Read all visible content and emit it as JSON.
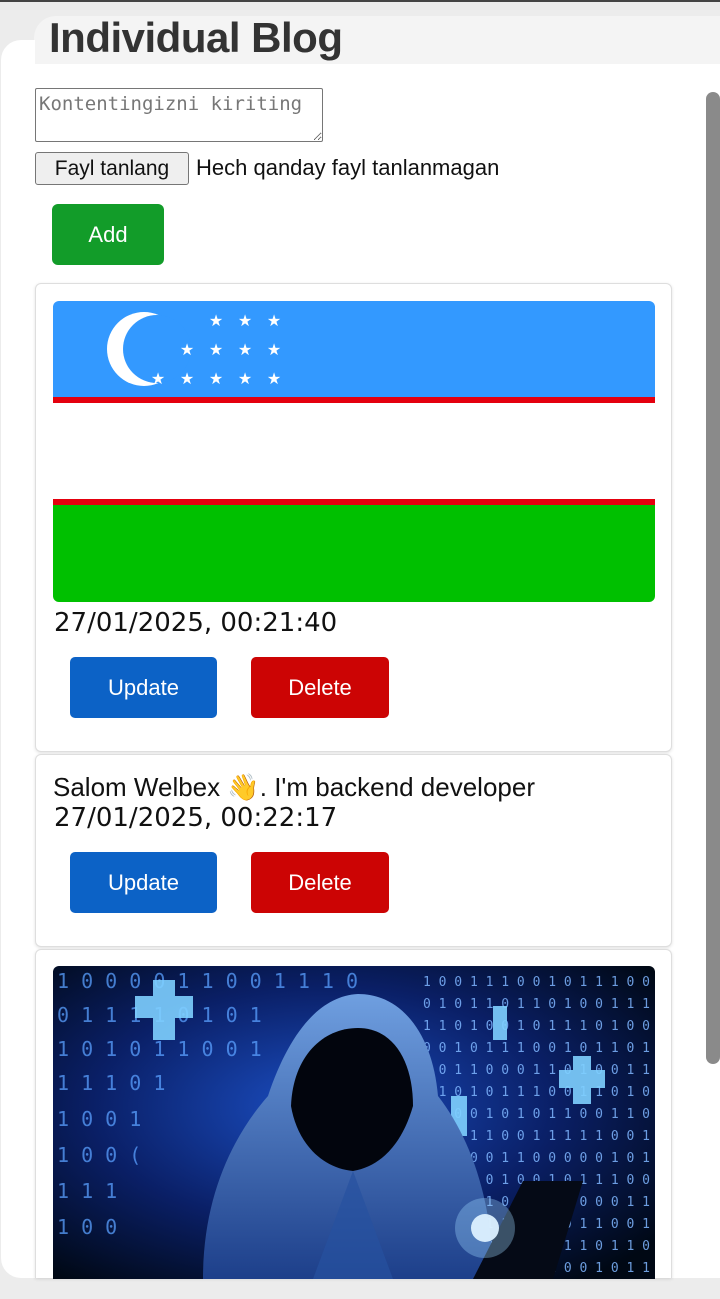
{
  "header": {
    "title": "Individual Blog"
  },
  "form": {
    "content_placeholder": "Kontentingizni kiriting",
    "file_button_label": "Fayl tanlang",
    "file_status": "Hech qanday fayl tanlanmagan",
    "add_label": "Add"
  },
  "posts": [
    {
      "kind": "image",
      "image": "uzbekistan-flag",
      "timestamp": "27/01/2025, 00:21:40",
      "update_label": "Update",
      "delete_label": "Delete"
    },
    {
      "kind": "text",
      "text_before": "Salom Welbex ",
      "emoji": "👋",
      "text_after": ". I'm backend developer",
      "timestamp": "27/01/2025, 00:22:17",
      "update_label": "Update",
      "delete_label": "Delete"
    },
    {
      "kind": "image",
      "image": "hooded-hacker-binary-code"
    }
  ],
  "colors": {
    "add_button": "#129c29",
    "update_button": "#0c62c6",
    "delete_button": "#cc0404",
    "flag_blue": "#3399ff",
    "flag_green": "#00c000",
    "flag_red": "#e4000e"
  }
}
